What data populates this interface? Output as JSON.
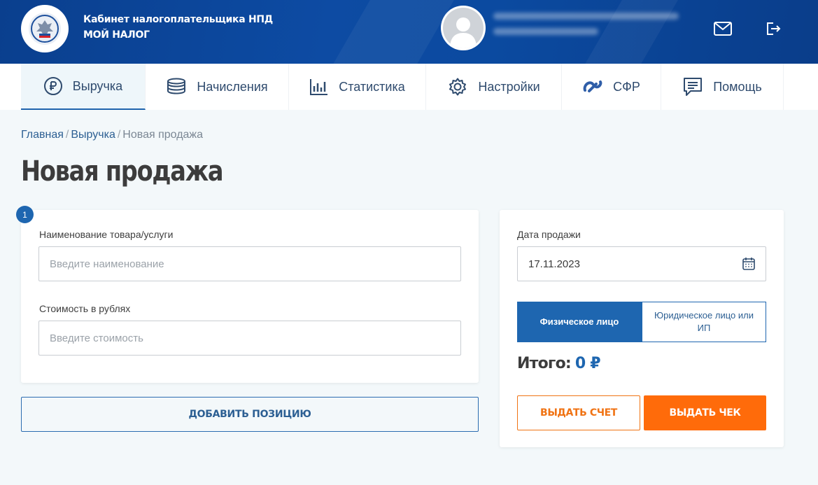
{
  "header": {
    "title_line1": "Кабинет налогоплательщика НПД",
    "title_line2": "МОЙ НАЛОГ",
    "mail_icon": "envelope-icon",
    "logout_icon": "logout-icon"
  },
  "nav": {
    "items": [
      {
        "label": "Выручка",
        "icon": "ruble-circle-icon",
        "active": true
      },
      {
        "label": "Начисления",
        "icon": "coins-stack-icon"
      },
      {
        "label": "Статистика",
        "icon": "bar-chart-icon"
      },
      {
        "label": "Настройки",
        "icon": "gear-icon"
      },
      {
        "label": "СФР",
        "icon": "sfr-logo-icon"
      },
      {
        "label": "Помощь",
        "icon": "chat-help-icon"
      }
    ]
  },
  "breadcrumb": {
    "home": "Главная",
    "revenue": "Выручка",
    "current": "Новая продажа",
    "separator": "/"
  },
  "page_title": "Новая продажа",
  "item_form": {
    "position_number": "1",
    "name_label": "Наименование товара/услуги",
    "name_placeholder": "Введите наименование",
    "price_label": "Стоимость в рублях",
    "price_placeholder": "Введите стоимость"
  },
  "add_position_label": "ДОБАВИТЬ ПОЗИЦИЮ",
  "sale": {
    "date_label": "Дата продажи",
    "date_value": "17.11.2023",
    "buyer_individual": "Физическое лицо",
    "buyer_legal": "Юридическое лицо или ИП",
    "total_label": "Итого:",
    "total_value": "0 ₽",
    "invoice_label": "ВЫДАТЬ СЧЕТ",
    "receipt_label": "ВЫДАТЬ ЧЕК"
  },
  "colors": {
    "header_blue": "#0d4ba3",
    "accent_blue": "#1e66b0",
    "orange": "#ff6b0a"
  }
}
